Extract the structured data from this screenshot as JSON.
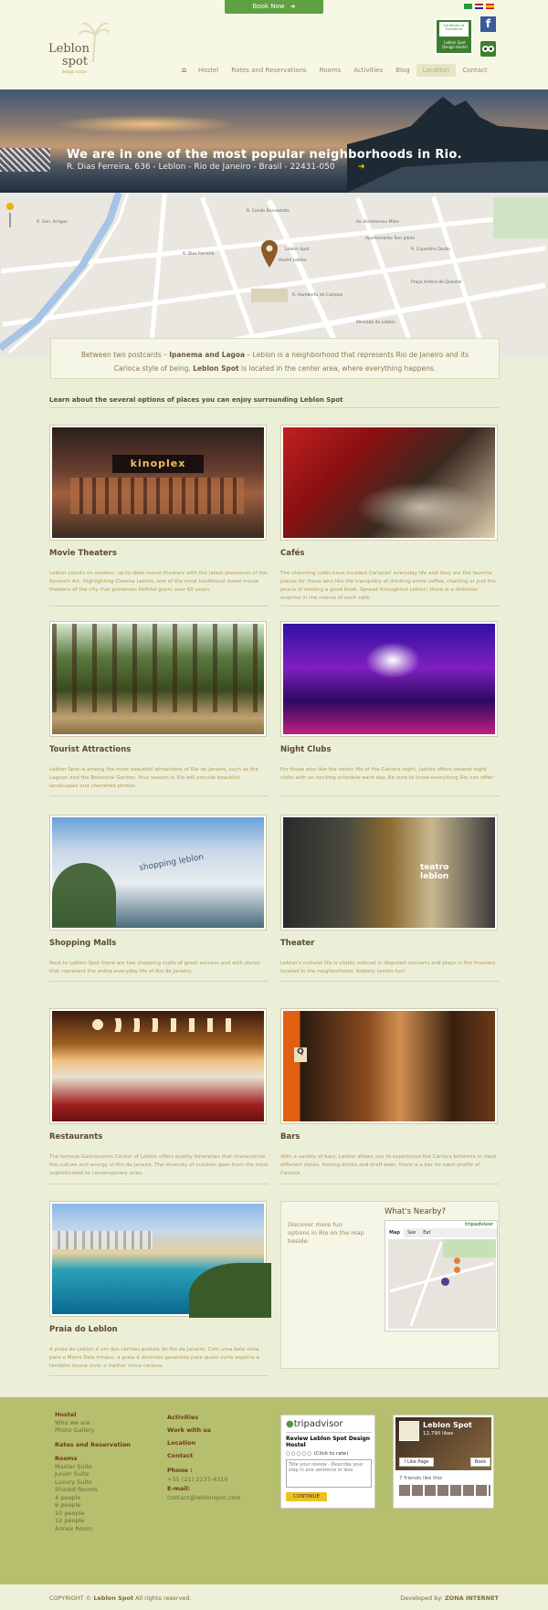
{
  "header": {
    "book_now": "Book Now",
    "logo_line1": "Leblon",
    "logo_line2": "spot",
    "logo_tagline": "design hostel",
    "trip_badge_top": "Certificate of Excellence",
    "trip_badge_name": "Leblon Spot Design Hostel",
    "facebook_letter": "f",
    "nav": [
      "Hostel",
      "Rates and Reservations",
      "Rooms",
      "Activities",
      "Blog",
      "Location",
      "Contact"
    ],
    "nav_active": "Location"
  },
  "hero": {
    "title": "We are in one of the most popular neighborhoods in Rio.",
    "address": "R. Dias Ferreira, 636 - Leblon - Rio de Janeiro - Brasil - 22431-050"
  },
  "map": {
    "labels": [
      "R. Conde Bernadotte",
      "Av. Bartolomeu Mitre",
      "R. Dias Ferreira",
      "R. Humberto de Campos",
      "R. Gen. Artigas",
      "Leblon Spot",
      "Hostel Leblon",
      "R. Cupertino Durão",
      "Praça Antero de Quental",
      "Apartamento Tom Jobim",
      "Mercado do Leblon"
    ]
  },
  "intro": {
    "p1": "Between two postcards – ",
    "b1": "Ipanema and Lagoa",
    "p2": " – Leblon is a neighborhood that represents Rio de Janeiro and its Carioca style of being. ",
    "b2": "Leblon Spot",
    "p3": " is located in the center area, where everything happens."
  },
  "learn_heading": "Learn about the several options of places you can enjoy surrounding Leblon Spot",
  "cards": [
    {
      "title": "Movie Theaters",
      "desc": "Leblon counts on modern, up-to-date movie theaters with the latest premieres of the Seventh Art. Highlighting Cinema Leblon, one of the most traditional street movie theaters of the city that preserves faithful goers over 60 years.",
      "sign": "kinoplex"
    },
    {
      "title": "Cafés",
      "desc": "The charming cafés have invaded Cariocas' everyday life and they are the favorite places for those who like the tranquility of drinking some coffee, chatting or just the peace of reading a good book. Spread throughout Leblon, there is a delicious surprise in the menus of each café."
    },
    {
      "title": "Tourist Attractions",
      "desc": "Leblon Spot is among the most beautiful attractions of Rio de Janeiro, such as the Lagoon and the Botanical Garden. Your season in Rio will provide beautiful landscapes and cherished photos."
    },
    {
      "title": "Night Clubs",
      "desc": "For those who like the hectic life of the Carioca night, Leblon offers several night clubs with an exciting schedule each day. Be sure to know everything Rio can offer!"
    },
    {
      "title": "Shopping Malls",
      "desc": "Next to Leblon Spot there are two shopping malls of great success and with stores that represent the entire everyday life of Rio de Janeiro.",
      "sign": "shopping leblon"
    },
    {
      "title": "Theater",
      "desc": "Leblon's cultural life is visibly noticed in disputed concerts and plays in the theaters located in the neighborhood. Nobody resists fun!",
      "sign": "teatro leblon"
    },
    {
      "title": "Restaurants",
      "desc": "The famous Gastronomic Center of Leblon offers quality itineraries that characterize the culture and energy of Rio de Janeiro. The diversity of cuisines goes from the most sophisticated to contemporary ones."
    },
    {
      "title": "Bars",
      "desc": "With a variety of bars, Leblon allows you to experience the Carioca bohemia in most different styles. Among drinks and draft beer, there is a bar for each profile of Carioca."
    },
    {
      "title": "Praia do Leblon",
      "desc": "A praia do Leblon é um dos cartões postais do Rio de Janeiro. Com uma bela vista para o Morro Dois Irmãos, a praia é diversão garantida para quem curte esporte e também busca viver o melhor clima carioca."
    }
  ],
  "nearby": {
    "text": "Discover more fun options in Rio on the map beside:",
    "title": "What's Nearby?",
    "tabs": [
      "Map",
      "See",
      "Eat"
    ],
    "provider": "tripadvisor"
  },
  "footer": {
    "col1": {
      "hostel": "Hostel",
      "hostel_items": [
        "Who we are",
        "Photo Gallery"
      ],
      "rates": "Rates and Reservation",
      "rooms": "Rooms",
      "room_items": [
        "Master Suite",
        "Junior Suite",
        "Luxury Suite",
        "Shared Rooms",
        "4 people",
        "6 people",
        "10 people",
        "12 people",
        "Annex Room"
      ]
    },
    "col2": {
      "activities": "Activities",
      "work": "Work with us",
      "location": "Location",
      "contact": "Contact",
      "phone_label": "Phone :",
      "phone": "+55 (21) 2137-4310",
      "email_label": "E-mail:",
      "email": "contact@leblonspot.com"
    },
    "tripadvisor": {
      "logo": "tripadvisor",
      "review_title": "Review Leblon Spot Design Hostel",
      "rate": "(Click to rate)",
      "placeholder": "Title your review - Describe your stay in one sentence or less.",
      "button": "CONTINUE"
    },
    "facebook": {
      "name": "Leblon Spot",
      "likes": "12,790 likes",
      "like_button": "Like Page",
      "book": "Book",
      "friends": "7 friends like this"
    }
  },
  "bottom": {
    "copyright_prefix": "COPYRIGHT © ",
    "copyright_name": "Leblon Spot",
    "copyright_suffix": " All rights reserved.",
    "developed_label": "Developed by: ",
    "developer": "ZONA INTERNET"
  },
  "colors": {
    "accent_green": "#5fa140",
    "footer_bg": "#b5bf6d",
    "page_bg": "#ecefd8",
    "title_brown": "#5a4a2e"
  }
}
